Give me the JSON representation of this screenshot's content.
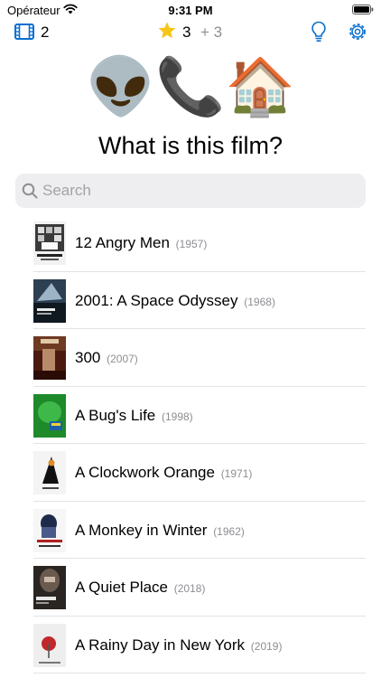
{
  "status_bar": {
    "carrier": "Opérateur",
    "time": "9:31 PM"
  },
  "toolbar": {
    "film_count": "2",
    "stars": "3",
    "stars_bonus": "+ 3"
  },
  "clue": {
    "emoji": "👽📞🏠"
  },
  "question": "What is this film?",
  "search": {
    "placeholder": "Search"
  },
  "films": [
    {
      "title": "12 Angry Men",
      "year": "(1957)"
    },
    {
      "title": "2001: A Space Odyssey",
      "year": "(1968)"
    },
    {
      "title": "300",
      "year": "(2007)"
    },
    {
      "title": "A Bug's Life",
      "year": "(1998)"
    },
    {
      "title": "A Clockwork Orange",
      "year": "(1971)"
    },
    {
      "title": "A Monkey in Winter",
      "year": "(1962)"
    },
    {
      "title": "A Quiet Place",
      "year": "(2018)"
    },
    {
      "title": "A Rainy Day in New York",
      "year": "(2019)"
    }
  ],
  "colors": {
    "accent": "#0a6fd0",
    "star": "#f5c518",
    "secondary": "#8e8e93"
  }
}
